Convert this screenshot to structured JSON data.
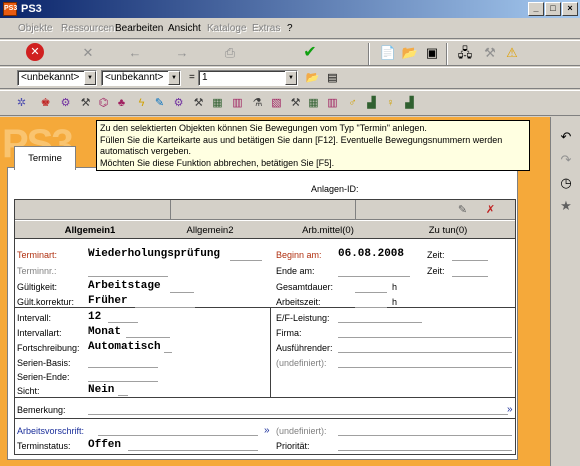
{
  "window": {
    "title": "PS3",
    "icon": "PS3",
    "controls": [
      "_",
      "□",
      "×"
    ]
  },
  "menu": [
    "Objekte",
    "Ressourcen",
    "Bearbeiten",
    "Ansicht",
    "Kataloge",
    "Extras",
    "?"
  ],
  "filter": {
    "combo1": "<unbekannt>",
    "combo2": "<unbekannt>",
    "eq": "=",
    "value": "1"
  },
  "tooltip": {
    "line1": "Zu den selektierten Objekten können Sie Bewegungen vom Typ \"Termin\" anlegen.",
    "line2": "Füllen Sie die Karteikarte aus und betätigen Sie dann [F12]. Eventuelle Bewegungsnummern werden",
    "line3": "automatisch vergeben.",
    "line4": "Möchten Sie diese Funktion abbrechen, betätigen Sie [F5]."
  },
  "tab": {
    "label": "Termine"
  },
  "bg_text": "PS3",
  "anlagen_label": "Anlagen-ID:",
  "subtabs": [
    "Allgemein1",
    "Allgemein2",
    "Arb.mittel(0)",
    "Zu tun(0)"
  ],
  "fields": {
    "terminart_label": "Terminart:",
    "terminart_value": "Wiederholungsprüfung",
    "terminnr_label": "Terminnr.:",
    "gueltigkeit_label": "Gültigkeit:",
    "gueltigkeit_value": "Arbeitstage",
    "gueltkorr_label": "Gült.korrektur:",
    "gueltkorr_value": "Früher",
    "beginn_label": "Beginn am:",
    "beginn_value": "06.08.2008",
    "ende_label": "Ende am:",
    "gesamt_label": "Gesamtdauer:",
    "gesamt_unit": "h",
    "arbeitszeit_label": "Arbeitszeit:",
    "arbeitszeit_unit": "h",
    "zeit1_label": "Zeit:",
    "zeit2_label": "Zeit:",
    "intervall_label": "Intervall:",
    "intervall_value": "12",
    "intervallart_label": "Intervallart:",
    "intervallart_value": "Monat",
    "fortschreibung_label": "Fortschreibung:",
    "fortschreibung_value": "Automatisch",
    "serienbasis_label": "Serien-Basis:",
    "serienende_label": "Serien-Ende:",
    "sicht_label": "Sicht:",
    "sicht_value": "Nein",
    "efleistung_label": "E/F-Leistung:",
    "firma_label": "Firma:",
    "ausfuehrender_label": "Ausführender:",
    "undef1_label": "(undefiniert):",
    "bemerkung_label": "Bemerkung:",
    "arbeitsvorschrift_label": "Arbeitsvorschrift:",
    "undef2_label": "(undefiniert):",
    "terminstatus_label": "Terminstatus:",
    "terminstatus_value": "Offen",
    "prioritaet_label": "Priorität:"
  },
  "colors": {
    "accent_orange": "#f5a93a",
    "title_blue": "#0a246a",
    "link_blue": "#1a2e9a",
    "red_label": "#b03010"
  }
}
